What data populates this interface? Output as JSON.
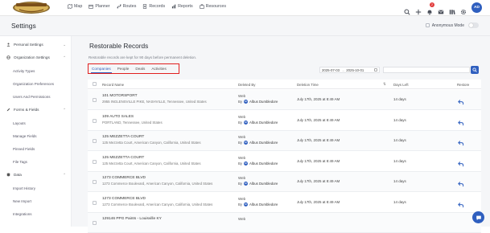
{
  "brand": {
    "logo_text": "ROUNDTABLE"
  },
  "nav": [
    {
      "label": "Map",
      "icon": "map-icon"
    },
    {
      "label": "Planner",
      "icon": "calendar-icon"
    },
    {
      "label": "Routes",
      "icon": "routes-icon"
    },
    {
      "label": "Records",
      "icon": "records-icon"
    },
    {
      "label": "Reports",
      "icon": "reports-icon"
    },
    {
      "label": "Resources",
      "icon": "resources-icon"
    }
  ],
  "top_right": {
    "notification_count": "2",
    "avatar_initials": "AD"
  },
  "header": {
    "title": "Settings",
    "anonymous_label": "Anonymous Mode"
  },
  "sidebar": {
    "sections": [
      {
        "label": "Personal Settings",
        "icon": "person-icon",
        "items": []
      },
      {
        "label": "Organization Settings",
        "icon": "globe-icon",
        "items": [
          "Activity Types",
          "Organization Preferences",
          "Users And Permissions"
        ]
      },
      {
        "label": "Forms & Fields",
        "icon": "pencil-icon",
        "items": [
          "Layouts",
          "Manage Fields",
          "Pinned Fields",
          "File Tags"
        ]
      },
      {
        "label": "Data",
        "icon": "database-icon",
        "items": [
          "Import History",
          "New Import",
          "Integrations"
        ]
      }
    ]
  },
  "main": {
    "title": "Restorable Records",
    "note": "Restorable records are kept for 90 days before permanent deletion.",
    "tabs": [
      "Companies",
      "People",
      "Deals",
      "Activities"
    ],
    "active_tab": 0,
    "date_from": "2025-07-03",
    "date_sep": "→",
    "date_to": "2025-10-01"
  },
  "table": {
    "headers": {
      "name": "Record Name",
      "deleted_by": "Deleted By",
      "deletion_time": "Deletion Time",
      "days_left": "Days Left",
      "restore": "Restore"
    },
    "rows": [
      {
        "name": "101 MOTORSPORT",
        "address": "2955 INGLENSVILLE PIKE, NASHVILLE, Tennessee, United States",
        "source": "Web",
        "by_prefix": "By",
        "by_initials": "AD",
        "by_name": "Albus Dumbledore",
        "time": "July 17th, 2025 at 8:49 AM",
        "days": "14 days"
      },
      {
        "name": "109 AUTO SALES",
        "address": "PORTLAND, Tennessee, United States",
        "source": "Web",
        "by_prefix": "By",
        "by_initials": "AD",
        "by_name": "Albus Dumbledore",
        "time": "July 17th, 2025 at 8:49 AM",
        "days": "14 days"
      },
      {
        "name": "125 MEZZETTA COURT",
        "address": "125 Mezzetta Court, American Canyon, California, United States",
        "source": "Web",
        "by_prefix": "By",
        "by_initials": "AD",
        "by_name": "Albus Dumbledore",
        "time": "July 17th, 2025 at 8:49 AM",
        "days": "14 days"
      },
      {
        "name": "125 MEZZETTA COURT",
        "address": "125 Mezzetta Court, American Canyon, California, United States",
        "source": "Web",
        "by_prefix": "By",
        "by_initials": "AD",
        "by_name": "Albus Dumbledore",
        "time": "July 17th, 2025 at 8:49 AM",
        "days": "14 days"
      },
      {
        "name": "1273 COMMERCE BLVD",
        "address": "1273 Commerce Boulevard, American Canyon, California, United States",
        "source": "Web",
        "by_prefix": "By",
        "by_initials": "AD",
        "by_name": "Albus Dumbledore",
        "time": "July 17th, 2025 at 8:49 AM",
        "days": "14 days"
      },
      {
        "name": "1273 COMMERCE BLVD",
        "address": "1273 Commerce Boulevard, American Canyon, California, United States",
        "source": "Web",
        "by_prefix": "By",
        "by_initials": "AD",
        "by_name": "Albus Dumbledore",
        "time": "July 17th, 2025 at 8:49 AM",
        "days": "14 days"
      },
      {
        "name": "129146 PPG Paints - Louisville KY",
        "address": "",
        "source": "Web",
        "by_prefix": "",
        "by_initials": "",
        "by_name": "",
        "time": "",
        "days": ""
      }
    ]
  },
  "colors": {
    "accent": "#2f5fbf",
    "highlight_box": "#e11f1f",
    "notification": "#e23b3b"
  }
}
